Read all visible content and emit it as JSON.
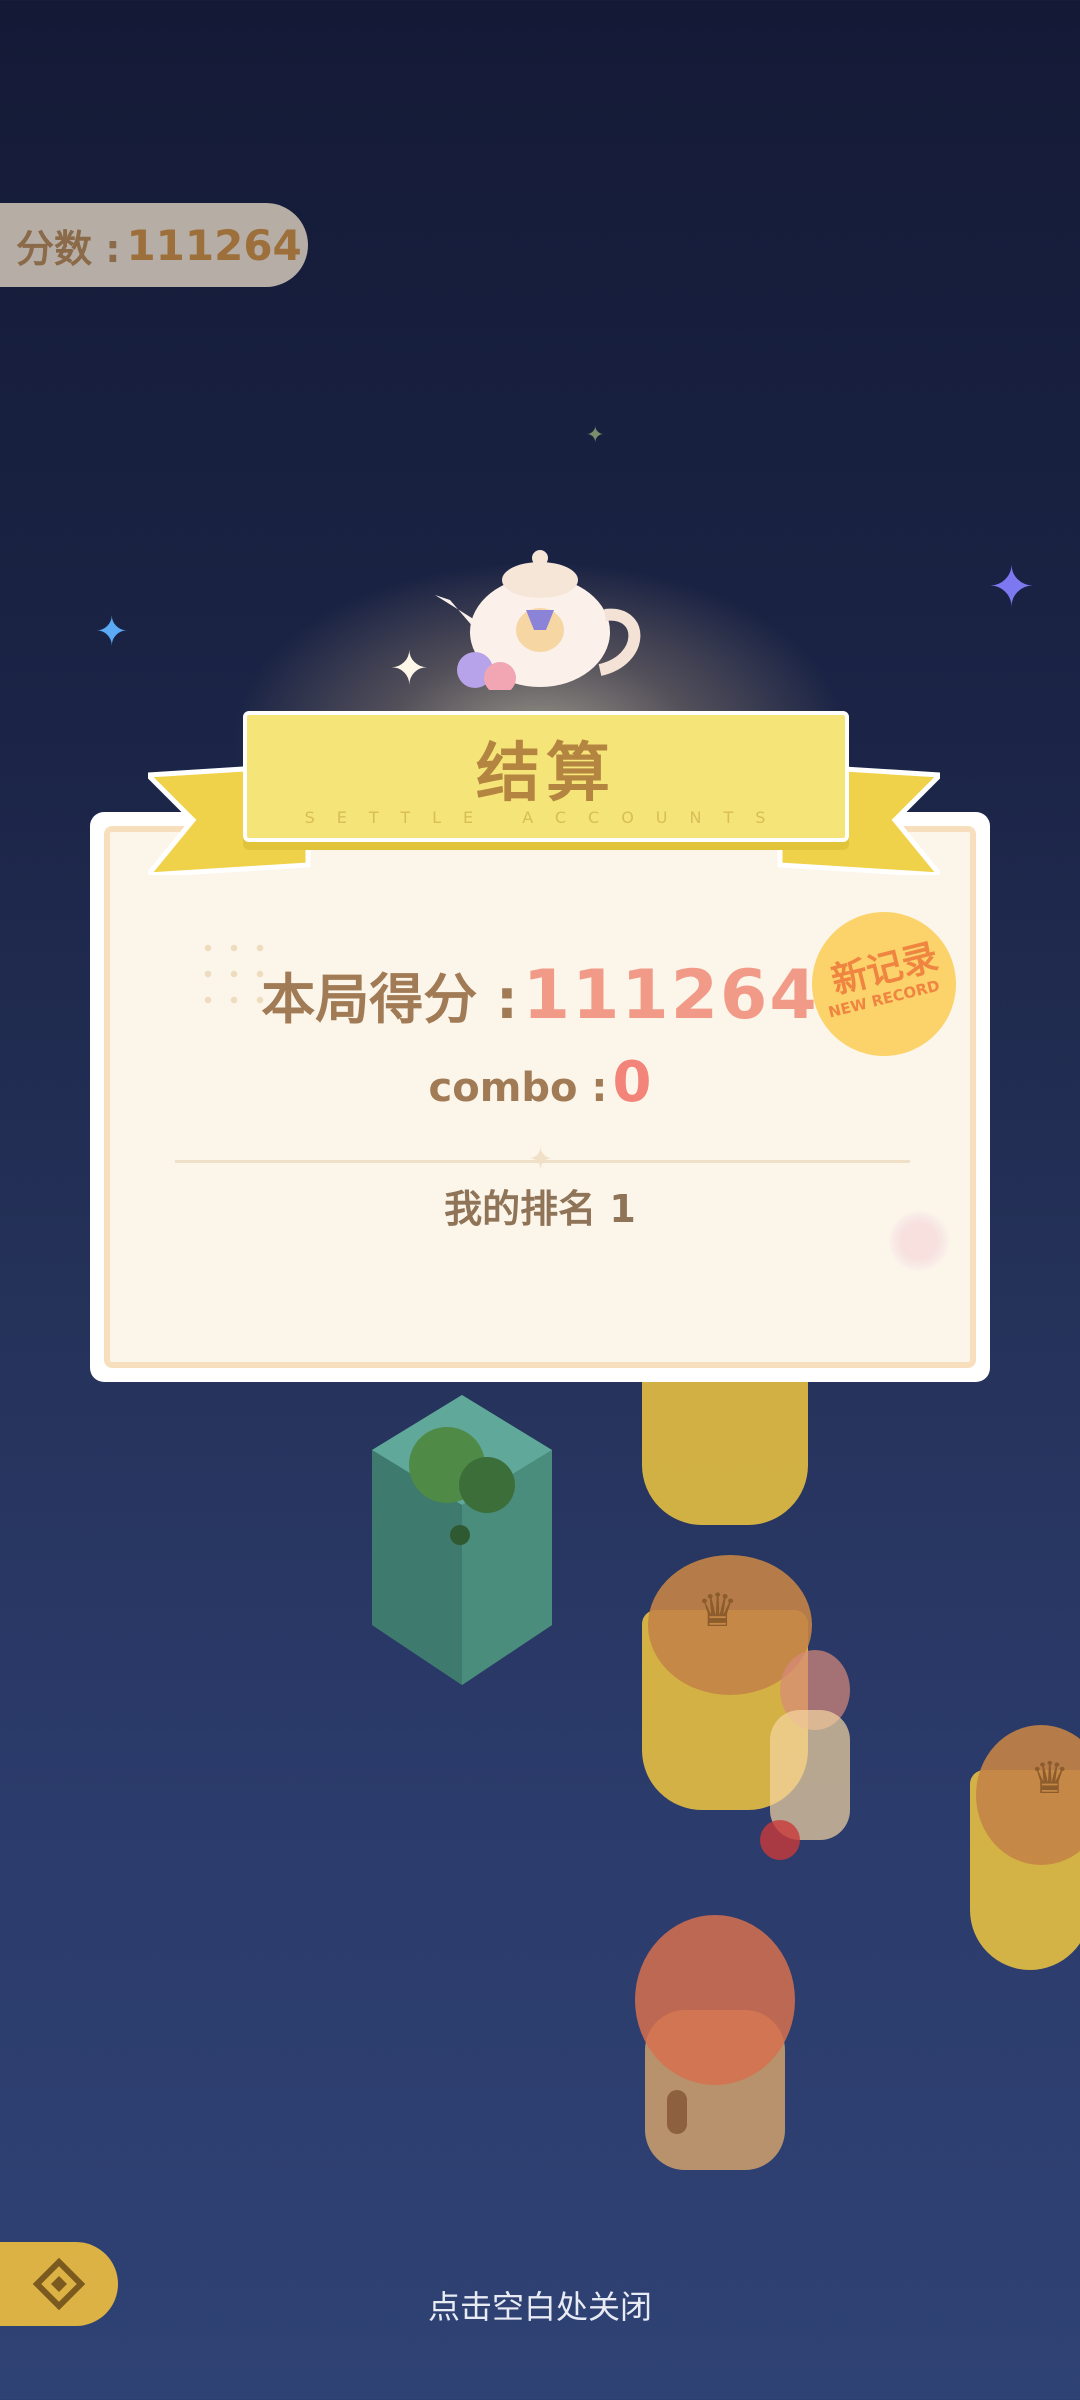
{
  "hud": {
    "score_label": "分数 :",
    "score_value": "111264"
  },
  "result_panel": {
    "title": "结算",
    "subtitle": "SETTLE ACCOUNTS",
    "score_label": "本局得分 :",
    "score_value": "111264",
    "combo_label": "combo :",
    "combo_value": "0",
    "rank_text": "我的排名 1",
    "badge_main": "新记录",
    "badge_sub": "NEW RECORD"
  },
  "footer": {
    "close_hint": "点击空白处关闭",
    "back_icon": "back-diamond-icon"
  },
  "colors": {
    "background_top": "#141a36",
    "background_bottom": "#2f4274",
    "ribbon": "#f5e477",
    "score_value": "#f29a88",
    "badge": "#fbd36a"
  }
}
